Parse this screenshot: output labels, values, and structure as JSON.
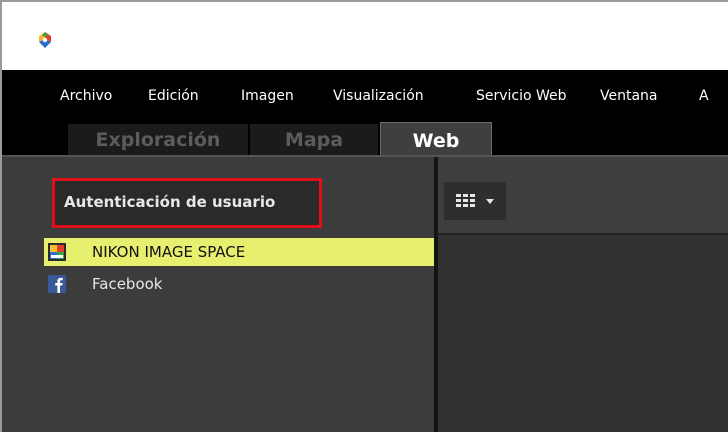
{
  "menu": {
    "items": [
      "Archivo",
      "Edición",
      "Imagen",
      "Visualización",
      "Servicio Web",
      "Ventana",
      "A"
    ]
  },
  "tabs": {
    "exploracion": "Exploración",
    "mapa": "Mapa",
    "web": "Web",
    "active": "Web"
  },
  "sidebar": {
    "auth_label": "Autenticación de usuario",
    "services": [
      {
        "label": "NIKON IMAGE SPACE",
        "icon": "nikon-image-space-icon",
        "selected": true
      },
      {
        "label": "Facebook",
        "icon": "facebook-icon",
        "selected": false
      }
    ]
  },
  "toolbar": {
    "view_icon": "grid-view-icon",
    "dropdown_icon": "chevron-down-icon"
  },
  "colors": {
    "highlight": "#e7ef6e",
    "annotation_box": "#e0101a",
    "facebook_blue": "#3b5998"
  }
}
